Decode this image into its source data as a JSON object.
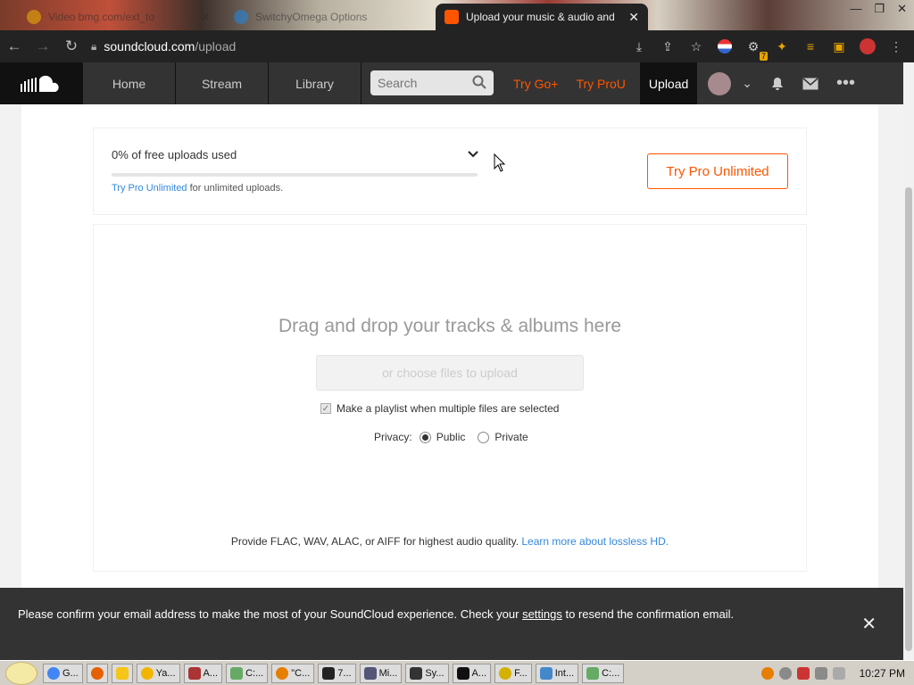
{
  "browser": {
    "tabs": [
      {
        "title": "Video bmg.com/ext_to",
        "active": false
      },
      {
        "title": "SwitchyOmega Options",
        "active": false
      },
      {
        "title": "Upload your music & audio and",
        "active": true
      }
    ],
    "address": {
      "host": "soundcloud.com",
      "path": "/upload"
    },
    "extension_badge": "7"
  },
  "header": {
    "nav": [
      "Home",
      "Stream",
      "Library"
    ],
    "search_placeholder": "Search",
    "try_go": "Try Go+",
    "try_pro": "Try ProU",
    "upload": "Upload"
  },
  "quota": {
    "title": "0% of free uploads used",
    "progress": 0,
    "note_link": "Try Pro Unlimited",
    "note_rest": " for unlimited uploads.",
    "button": "Try Pro Unlimited"
  },
  "upload": {
    "headline": "Drag and drop your tracks & albums here",
    "choose_button": "or choose files to upload",
    "playlist_label": "Make a playlist when multiple files are selected",
    "privacy_label": "Privacy:",
    "privacy_public": "Public",
    "privacy_private": "Private",
    "quality_text": "Provide FLAC, WAV, ALAC, or AIFF for highest audio quality. ",
    "quality_link": "Learn more about lossless HD."
  },
  "notice": {
    "text_before": "Please confirm your email address to make the most of your SoundCloud experience. Check your ",
    "link": "settings",
    "text_after": " to resend the confirmation email."
  },
  "taskbar": {
    "tasks": [
      "G...",
      "",
      "",
      "Ya...",
      "A...",
      "C:...",
      "\"C...",
      "7...",
      "Mi...",
      "Sy...",
      "A...",
      "F...",
      "Int...",
      "C:..."
    ],
    "clock": "10:27 PM"
  },
  "colors": {
    "accent": "#ff5500",
    "header": "#333333",
    "link": "#3388dd"
  }
}
